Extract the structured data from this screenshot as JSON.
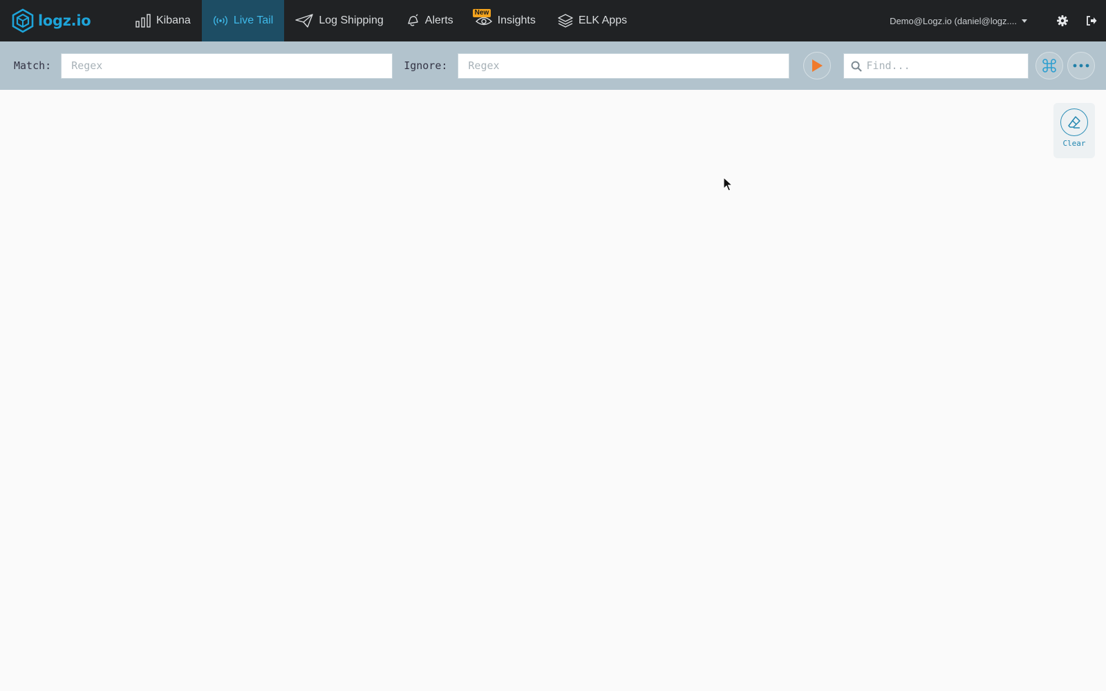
{
  "brand": {
    "name": "logz.io",
    "icon": "cube-logo-icon",
    "color": "#1ea4d9"
  },
  "nav": {
    "items": [
      {
        "label": "Kibana",
        "icon": "bar-chart-icon",
        "active": false
      },
      {
        "label": "Live Tail",
        "icon": "broadcast-icon",
        "active": true
      },
      {
        "label": "Log Shipping",
        "icon": "paper-plane-icon",
        "active": false
      },
      {
        "label": "Alerts",
        "icon": "bell-icon",
        "active": false
      },
      {
        "label": "Insights",
        "icon": "eye-icon",
        "active": false,
        "badge": "New"
      },
      {
        "label": "ELK Apps",
        "icon": "layers-icon",
        "active": false
      }
    ],
    "user": "Demo@Logz.io (daniel@logz....",
    "settings_icon": "gear-icon",
    "logout_icon": "sign-out-icon"
  },
  "filters": {
    "match_label": "Match:",
    "match_placeholder": "Regex",
    "ignore_label": "Ignore:",
    "ignore_placeholder": "Regex",
    "play_icon": "play-icon",
    "find_placeholder": "Find...",
    "command_icon": "command-icon",
    "more_icon": "ellipsis-icon"
  },
  "clear": {
    "label": "Clear",
    "icon": "eraser-icon"
  },
  "colors": {
    "topbar": "#202224",
    "active_tab": "#1d4d64",
    "accent": "#3fb9e9",
    "filterbar": "#b2c3cd",
    "play": "#f07a2c",
    "badge": "#f3a31e"
  }
}
